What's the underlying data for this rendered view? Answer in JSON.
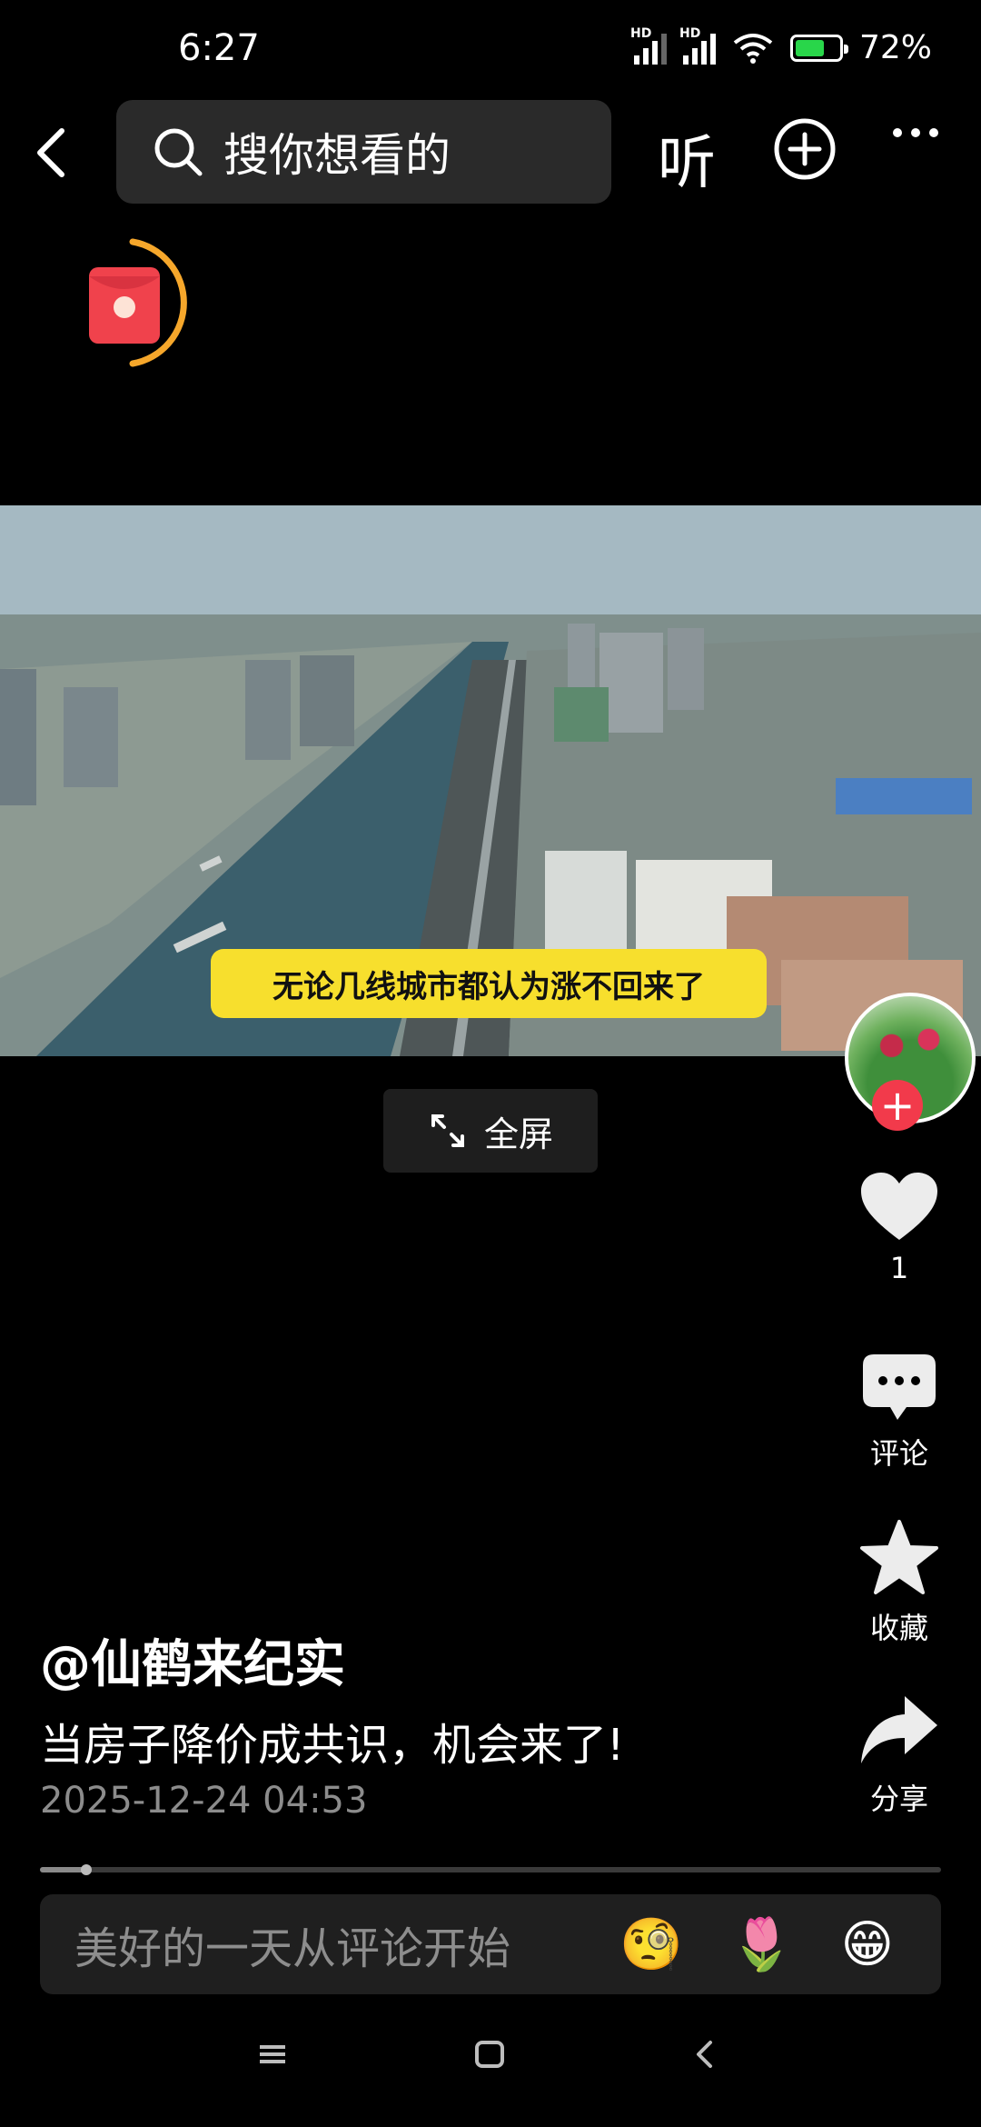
{
  "status_bar": {
    "time": "6:27",
    "battery": "72%",
    "battery_level": 0.72
  },
  "topbar": {
    "search_placeholder": "搜你想看的",
    "listen_label": "听"
  },
  "video": {
    "subtitle": "无论几线城市都认为涨不回来了",
    "fullscreen_label": "全屏"
  },
  "actions": {
    "like_count": "1",
    "comment_label": "评论",
    "favorite_label": "收藏",
    "share_label": "分享"
  },
  "post": {
    "author": "@仙鹤来纪实",
    "title": "当房子降价成共识，机会来了!",
    "date": "2025-12-24 04:53"
  },
  "playback": {
    "progress": 0.05
  },
  "comment": {
    "placeholder": "美好的一天从评论开始",
    "emojis": [
      "🧐",
      "🌷",
      "😁"
    ]
  }
}
